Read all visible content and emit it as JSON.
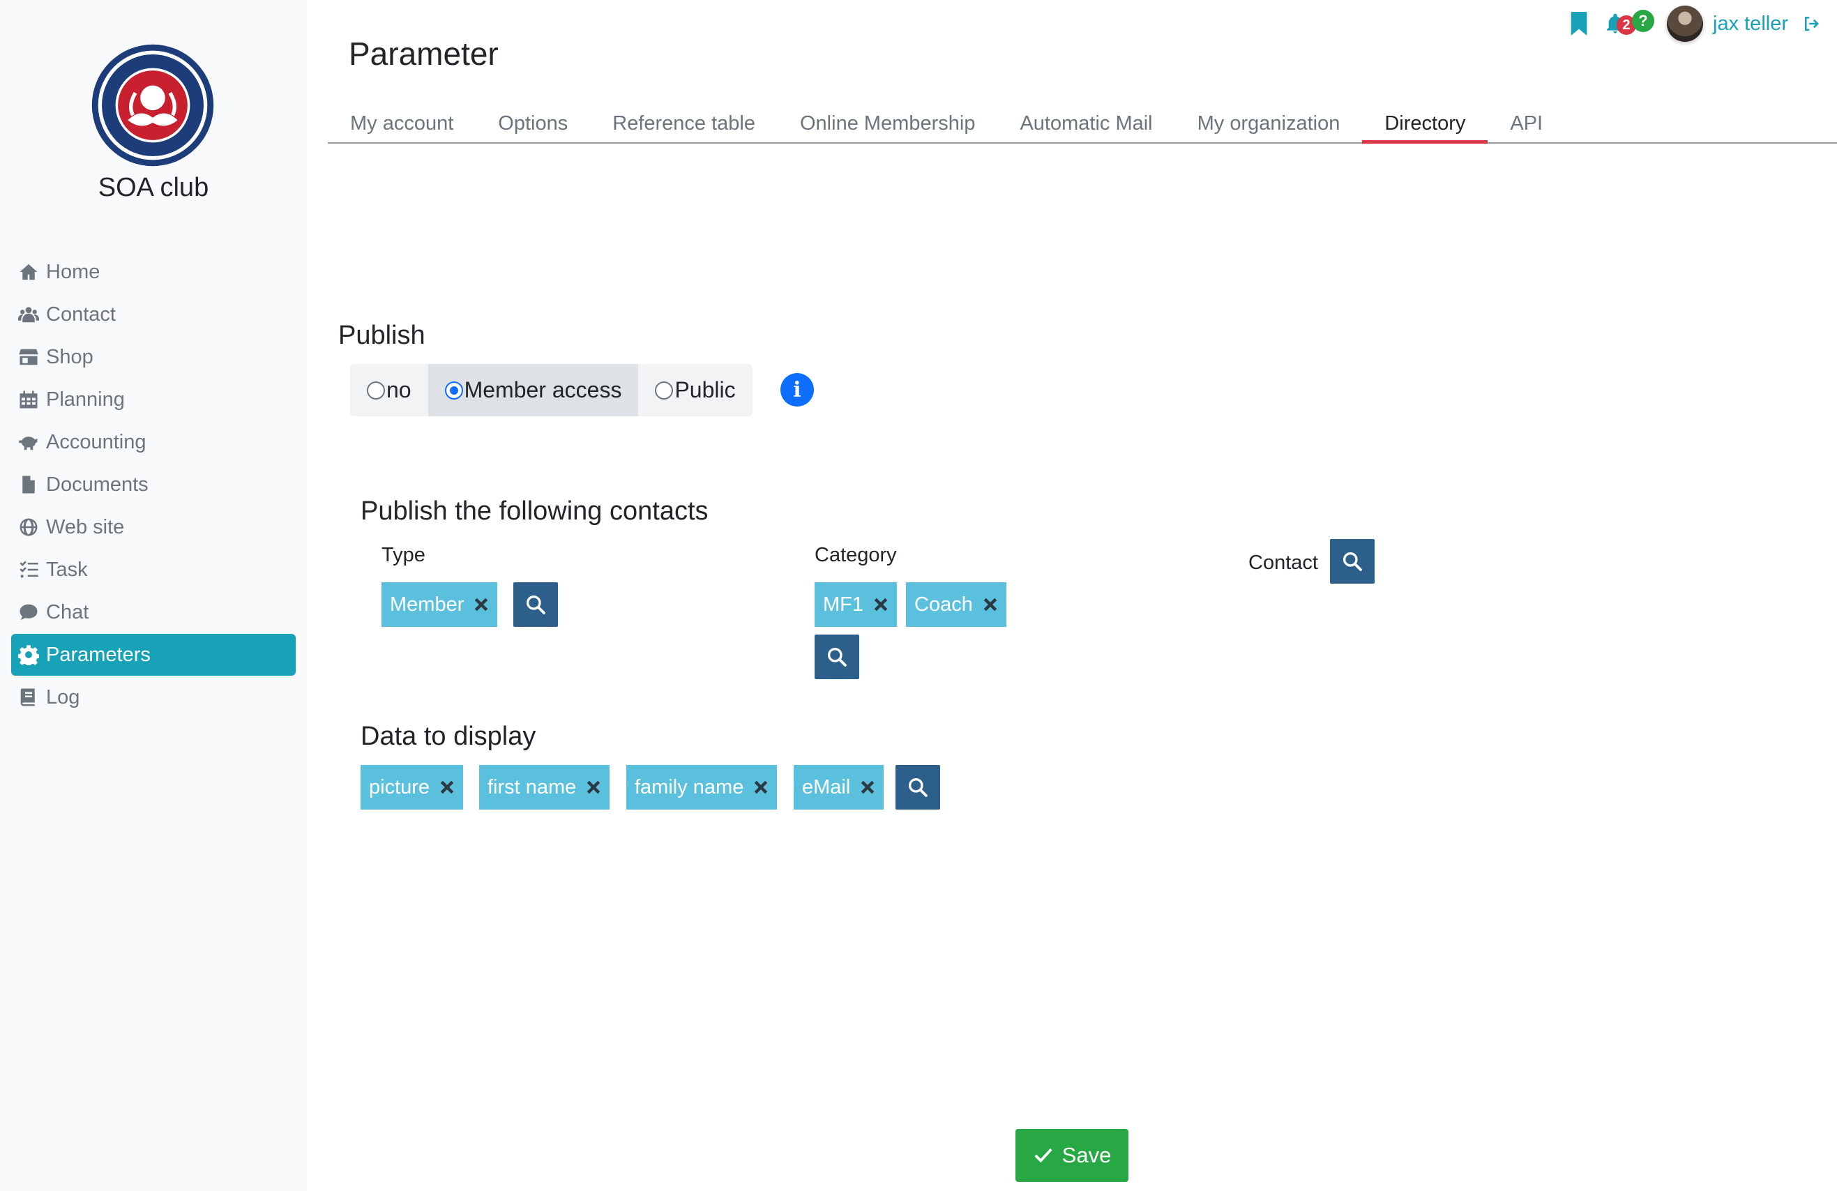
{
  "sidebar": {
    "club_name": "SOA club",
    "items": [
      {
        "label": "Home",
        "icon": "home-icon"
      },
      {
        "label": "Contact",
        "icon": "users-icon"
      },
      {
        "label": "Shop",
        "icon": "store-icon"
      },
      {
        "label": "Planning",
        "icon": "calendar-icon"
      },
      {
        "label": "Accounting",
        "icon": "piggy-bank-icon"
      },
      {
        "label": "Documents",
        "icon": "file-icon"
      },
      {
        "label": "Web site",
        "icon": "globe-icon"
      },
      {
        "label": "Task",
        "icon": "task-list-icon"
      },
      {
        "label": "Chat",
        "icon": "chat-icon"
      },
      {
        "label": "Parameters",
        "icon": "gear-icon",
        "active": true
      },
      {
        "label": "Log",
        "icon": "book-icon"
      }
    ]
  },
  "header": {
    "notification_count": "2",
    "help_badge": "?",
    "username": "jax teller"
  },
  "page": {
    "title": "Parameter",
    "tabs": [
      "My account",
      "Options",
      "Reference table",
      "Online Membership",
      "Automatic Mail",
      "My organization",
      "Directory",
      "API"
    ],
    "active_tab": "Directory"
  },
  "publish": {
    "heading": "Publish",
    "options": [
      "no",
      "Member access",
      "Public"
    ],
    "selected": "Member access"
  },
  "contacts": {
    "heading": "Publish the following contacts",
    "type_label": "Type",
    "type_tags": [
      "Member"
    ],
    "category_label": "Category",
    "category_tags": [
      "MF1",
      "Coach"
    ],
    "contact_label": "Contact"
  },
  "display": {
    "heading": "Data to display",
    "tags": [
      "picture",
      "first name",
      "family name",
      "eMail"
    ]
  },
  "save_label": "Save",
  "colors": {
    "accent": "#17a2b8",
    "tag": "#5bc0de",
    "search_button": "#2c5f8a",
    "save": "#28a745",
    "active_tab_underline": "#dc3545"
  }
}
